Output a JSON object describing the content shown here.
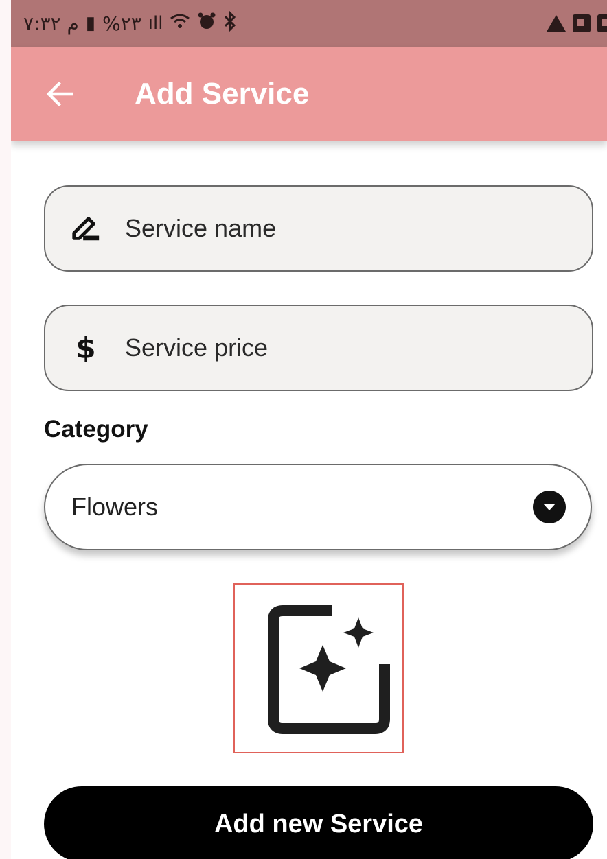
{
  "status_bar": {
    "time": "۷:۳۲ م",
    "battery": "%۲۳",
    "icons": [
      "battery-icon",
      "signal-icon",
      "wifi-icon",
      "alarm-icon",
      "bluetooth-icon",
      "warning-icon",
      "app-notification-icon",
      "image-notification-icon"
    ]
  },
  "app_bar": {
    "title": "Add Service",
    "back_icon": "arrow-left-icon",
    "color": "#ec9a9a"
  },
  "form": {
    "name_field": {
      "placeholder": "Service name",
      "value": "",
      "icon": "pencil-icon"
    },
    "price_field": {
      "placeholder": "Service price",
      "value": "",
      "icon": "dollar-icon"
    },
    "category_label": "Category",
    "category_dropdown": {
      "selected": "Flowers",
      "icon": "chevron-down-circle-icon"
    },
    "image_picker": {
      "icon": "sparkle-image-icon",
      "border_color": "#e0625a"
    },
    "submit_label": "Add new Service"
  }
}
